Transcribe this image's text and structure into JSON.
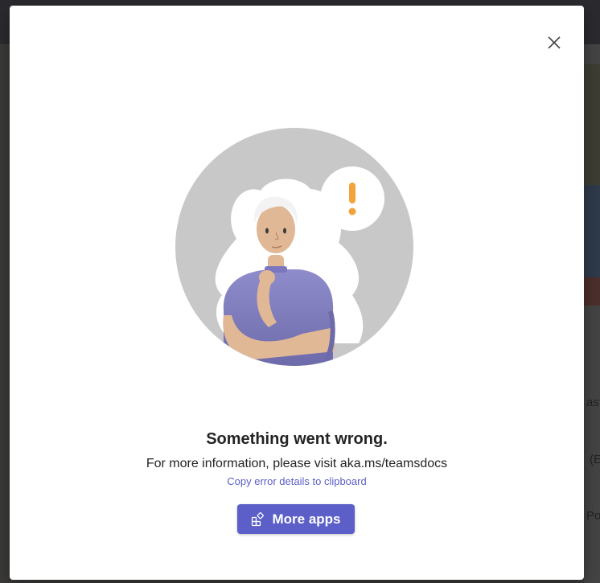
{
  "dialog": {
    "title": "Something went wrong.",
    "info_text": "For more information, please visit aka.ms/teamsdocs",
    "copy_link": "Copy error details to clipboard",
    "primary_button": "More apps",
    "close_icon": "close-icon",
    "button_icon": "apps-add-icon",
    "illustration": "confused-woman-thought-bubble-illustration"
  },
  "background": {
    "right_edge_text": [
      "ast",
      "(E",
      "Po"
    ]
  },
  "colors": {
    "accent": "#5b5fc7",
    "text": "#242424",
    "exclamation": "#f2a33a",
    "circle": "#c8c8c8",
    "shirt": "#8b88c9"
  }
}
